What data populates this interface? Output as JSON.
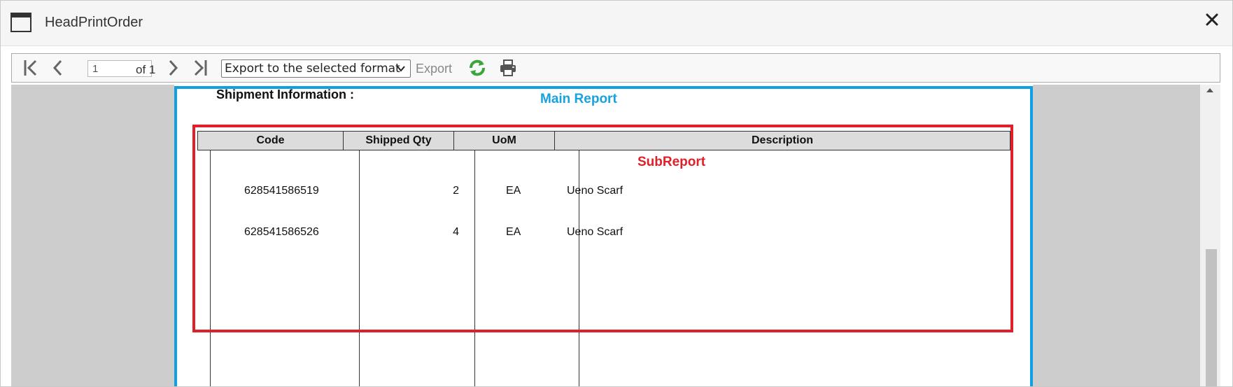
{
  "window": {
    "title": "HeadPrintOrder"
  },
  "toolbar": {
    "page_value": "1",
    "of_label": "of 1",
    "export_format": "Export to the selected format",
    "export_label": "Export",
    "icons": {
      "first": "first-page-icon",
      "prev": "prev-page-icon",
      "next": "next-page-icon",
      "last": "last-page-icon",
      "refresh": "refresh-icon",
      "print": "print-icon"
    }
  },
  "report": {
    "section_title": "Shipment Information :",
    "main_label": "Main Report",
    "sub_label": "SubReport",
    "columns": [
      "Code",
      "Shipped Qty",
      "UoM",
      "Description"
    ],
    "rows": [
      {
        "code": "628541586519",
        "qty": "2",
        "uom": "EA",
        "description": "Ueno Scarf"
      },
      {
        "code": "628541586526",
        "qty": "4",
        "uom": "EA",
        "description": "Ueno Scarf"
      }
    ]
  },
  "colors": {
    "main_frame": "#0ea0e3",
    "sub_frame": "#e02028",
    "refresh_green": "#3ba53b"
  }
}
